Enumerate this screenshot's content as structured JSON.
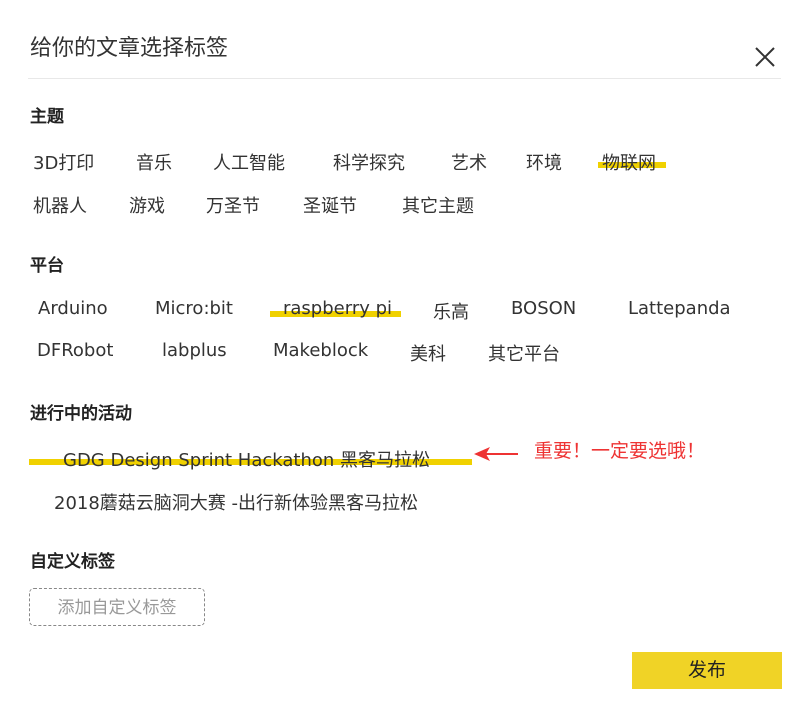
{
  "dialog": {
    "title": "给你的文章选择标签",
    "close_icon": "close-icon"
  },
  "sections": {
    "topic": {
      "title": "主题",
      "tags": [
        "3D打印",
        "音乐",
        "人工智能",
        "科学探究",
        "艺术",
        "环境",
        "物联网",
        "机器人",
        "游戏",
        "万圣节",
        "圣诞节",
        "其它主题"
      ],
      "selected": [
        "物联网"
      ]
    },
    "platform": {
      "title": "平台",
      "tags": [
        "Arduino",
        "Micro:bit",
        "raspberry pi",
        "乐高",
        "BOSON",
        "Lattepanda",
        "DFRobot",
        "labplus",
        "Makeblock",
        "美科",
        "其它平台"
      ],
      "selected": [
        "raspberry pi"
      ]
    },
    "activities": {
      "title": "进行中的活动",
      "items": [
        "GDG Design Sprint Hackathon 黑客马拉松",
        "2018蘑菇云脑洞大赛 -出行新体验黑客马拉松"
      ],
      "selected": [
        "GDG Design Sprint Hackathon 黑客马拉松"
      ]
    },
    "custom": {
      "title": "自定义标签",
      "add_label": "添加自定义标签"
    }
  },
  "annotation": {
    "text": "重要！一定要选哦！",
    "color": "#ee3333"
  },
  "highlight_color": "#f0d100",
  "publish_label": "发布",
  "publish_color": "#f0d326"
}
